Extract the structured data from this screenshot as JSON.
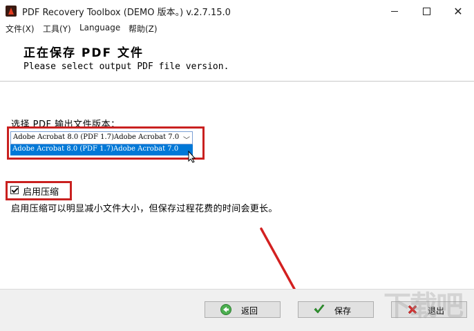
{
  "window": {
    "title": "PDF Recovery Toolbox (DEMO 版本。) v.2.7.15.0",
    "controls": {
      "minimize": "minimize",
      "maximize": "maximize",
      "close": "✕"
    }
  },
  "menu": {
    "items": [
      {
        "label": "文件(X)"
      },
      {
        "label": "工具(Y)"
      },
      {
        "label": "Language"
      },
      {
        "label": "帮助(Z)"
      }
    ]
  },
  "header": {
    "title": "正在保存 PDF 文件",
    "subtitle": "Please select output PDF file version."
  },
  "version": {
    "label": "选择 PDF 输出文件版本：",
    "selected": "Adobe Acrobat 8.0 (PDF 1.7)Adobe Acrobat 7.0",
    "highlighted_option": "Adobe Acrobat 8.0 (PDF 1.7)Adobe Acrobat 7.0"
  },
  "compression": {
    "checkbox_label": "启用压缩",
    "checked": true,
    "description": "启用压缩可以明显减小文件大小，但保存过程花费的时间会更长。"
  },
  "buttons": {
    "back": "返回",
    "save": "保存",
    "exit": "退出"
  },
  "colors": {
    "highlight_box": "#c9201f",
    "selection": "#0078d7",
    "back_icon": "#4caf50",
    "save_icon": "#2e9a2e",
    "exit_icon": "#d32f2f"
  },
  "watermark": "下载吧"
}
